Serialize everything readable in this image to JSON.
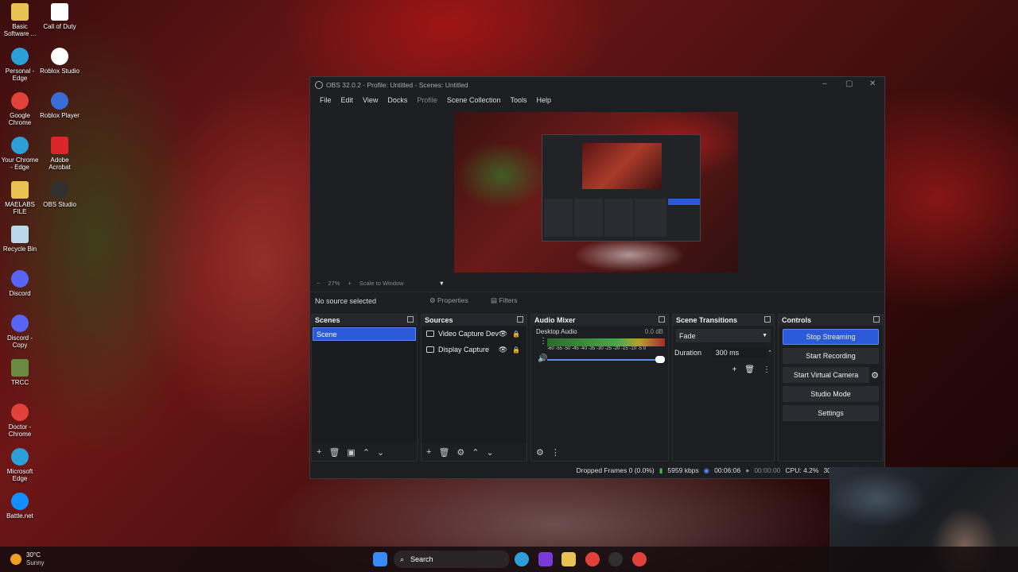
{
  "desktop": {
    "icons": [
      {
        "label": "Basic Software ...",
        "icon": "folder-icon",
        "color": "#e8c252"
      },
      {
        "label": "Call of Duty",
        "icon": "file-icon",
        "color": "#ffffff"
      },
      {
        "label": "Personal - Edge",
        "icon": "edge-icon",
        "color": "#2d9fd8"
      },
      {
        "label": "Roblox Studio",
        "icon": "roblox-studio-icon",
        "color": "#ffffff"
      },
      {
        "label": "Google Chrome",
        "icon": "chrome-icon",
        "color": "#e0413a"
      },
      {
        "label": "Roblox Player",
        "icon": "roblox-player-icon",
        "color": "#3a6cd8"
      },
      {
        "label": "Your Chrome - Edge",
        "icon": "edge-icon",
        "color": "#2d9fd8"
      },
      {
        "label": "Adobe Acrobat",
        "icon": "acrobat-icon",
        "color": "#d8262a"
      },
      {
        "label": "MAELABS FILE",
        "icon": "folder-icon",
        "color": "#e8c252"
      },
      {
        "label": "OBS Studio",
        "icon": "obs-icon",
        "color": "#303030"
      },
      {
        "label": "Recycle Bin",
        "icon": "recycle-bin-icon",
        "color": "#bcd8e8"
      },
      {
        "label": "Discord",
        "icon": "discord-icon",
        "color": "#5865f2"
      },
      {
        "label": "Discord - Copy",
        "icon": "discord-icon",
        "color": "#5865f2"
      },
      {
        "label": "TRCC",
        "icon": "trcc-icon",
        "color": "#6a8a40"
      },
      {
        "label": "Doctor - Chrome",
        "icon": "chrome-icon",
        "color": "#e0413a"
      },
      {
        "label": "Microsoft Edge",
        "icon": "edge-icon",
        "color": "#2d9fd8"
      },
      {
        "label": "Battle.net",
        "icon": "battlenet-icon",
        "color": "#148eff"
      }
    ]
  },
  "obs": {
    "title": "OBS 32.0.2 - Profile: Untitled - Scenes: Untitled",
    "menu": [
      "File",
      "Edit",
      "View",
      "Docks",
      "Profile",
      "Scene Collection",
      "Tools",
      "Help"
    ],
    "zoom": "27%",
    "scale_mode": "Scale to Window",
    "no_source": "No source selected",
    "properties_label": "Properties",
    "filters_label": "Filters",
    "docks": {
      "scenes": {
        "title": "Scenes",
        "items": [
          "Scene"
        ]
      },
      "sources": {
        "title": "Sources",
        "items": [
          "Video Capture Dev",
          "Display Capture"
        ]
      },
      "mixer": {
        "title": "Audio Mixer",
        "channel": "Desktop Audio",
        "db": "0.0 dB",
        "scale": "-60 -55 -50 -45 -40 -35 -30 -25 -20 -15 -10 -5 0"
      },
      "transitions": {
        "title": "Scene Transitions",
        "selected": "Fade",
        "duration_label": "Duration",
        "duration_value": "300 ms"
      },
      "controls": {
        "title": "Controls",
        "buttons": [
          "Stop Streaming",
          "Start Recording",
          "Start Virtual Camera",
          "Studio Mode",
          "Settings"
        ]
      }
    },
    "status": {
      "dropped": "Dropped Frames 0 (0.0%)",
      "bitrate": "5959 kbps",
      "stream_time": "00:06:06",
      "rec_time": "00:00:00",
      "cpu": "CPU: 4.2%",
      "fps": "30.0"
    }
  },
  "taskbar": {
    "weather_temp": "30°C",
    "weather_desc": "Sunny",
    "search_label": "Search"
  }
}
